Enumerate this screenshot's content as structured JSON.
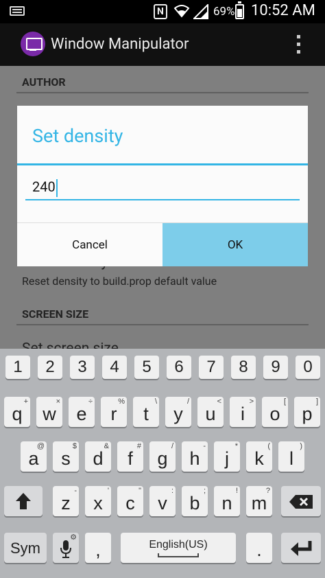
{
  "status_bar": {
    "battery_percent": "69%",
    "time": "10:52 AM",
    "nfc_label": "N"
  },
  "app_bar": {
    "title": "Window Manipulator"
  },
  "content": {
    "sections": [
      {
        "header": "AUTHOR"
      },
      {
        "header": "SCREEN SIZE"
      }
    ],
    "partial_items": [
      {
        "title": "Reset density",
        "subtitle": "Reset density to build.prop default value"
      },
      {
        "title": "Set screen size"
      }
    ]
  },
  "dialog": {
    "title": "Set density",
    "input_value": "240",
    "cancel_label": "Cancel",
    "ok_label": "OK",
    "accent_color": "#33b5e5"
  },
  "keyboard": {
    "number_row": [
      "1",
      "2",
      "3",
      "4",
      "5",
      "6",
      "7",
      "8",
      "9",
      "0"
    ],
    "row1": [
      {
        "key": "q",
        "hint": "+"
      },
      {
        "key": "w",
        "hint": "×"
      },
      {
        "key": "e",
        "hint": "÷"
      },
      {
        "key": "r",
        "hint": "%"
      },
      {
        "key": "t",
        "hint": "\\"
      },
      {
        "key": "y",
        "hint": "/"
      },
      {
        "key": "u",
        "hint": "<"
      },
      {
        "key": "i",
        "hint": ">"
      },
      {
        "key": "o",
        "hint": "["
      },
      {
        "key": "p",
        "hint": "]"
      }
    ],
    "row2": [
      {
        "key": "a",
        "hint": "@"
      },
      {
        "key": "s",
        "hint": "$"
      },
      {
        "key": "d",
        "hint": "&"
      },
      {
        "key": "f",
        "hint": "#"
      },
      {
        "key": "g",
        "hint": "/"
      },
      {
        "key": "h",
        "hint": "-"
      },
      {
        "key": "j",
        "hint": "*"
      },
      {
        "key": "k",
        "hint": "("
      },
      {
        "key": "l",
        "hint": ")"
      }
    ],
    "row3": [
      {
        "key": "z",
        "hint": "-"
      },
      {
        "key": "x",
        "hint": "'"
      },
      {
        "key": "c",
        "hint": "\""
      },
      {
        "key": "v",
        "hint": ":"
      },
      {
        "key": "b",
        "hint": ";"
      },
      {
        "key": "n",
        "hint": "!"
      },
      {
        "key": "m",
        "hint": "?"
      }
    ],
    "sym_label": "Sym",
    "comma_label": ",",
    "space_label": "English(US)",
    "period_label": "."
  }
}
